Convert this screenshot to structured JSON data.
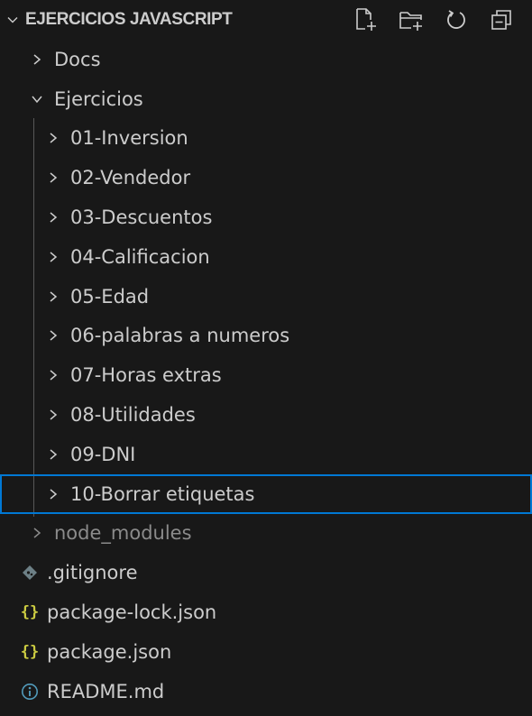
{
  "explorer": {
    "title": "EJERCICIOS JAVASCRIPT",
    "actions": [
      {
        "name": "new-file-icon"
      },
      {
        "name": "new-folder-icon"
      },
      {
        "name": "refresh-icon"
      },
      {
        "name": "collapse-all-icon"
      }
    ],
    "tree": {
      "docs": "Docs",
      "ejercicios": "Ejercicios",
      "subfolders": [
        "01-Inversion",
        "02-Vendedor",
        "03-Descuentos",
        "04-Calificacion",
        "05-Edad",
        "06-palabras a numeros",
        "07-Horas extras",
        "08-Utilidades",
        "09-DNI",
        "10-Borrar etiquetas"
      ],
      "node_modules": "node_modules",
      "files": [
        {
          "label": ".gitignore",
          "icon": "git-diamond-icon"
        },
        {
          "label": "package-lock.json",
          "icon": "json-braces-icon"
        },
        {
          "label": "package.json",
          "icon": "json-braces-icon"
        },
        {
          "label": "README.md",
          "icon": "info-icon"
        }
      ]
    },
    "colors": {
      "background": "#181818",
      "text": "#cccccc",
      "dim_text": "#8b8b8b",
      "selection_border": "#0078d4",
      "json_icon": "#cbcb41",
      "info_icon": "#519aba",
      "git_icon": "#6d8086"
    }
  }
}
